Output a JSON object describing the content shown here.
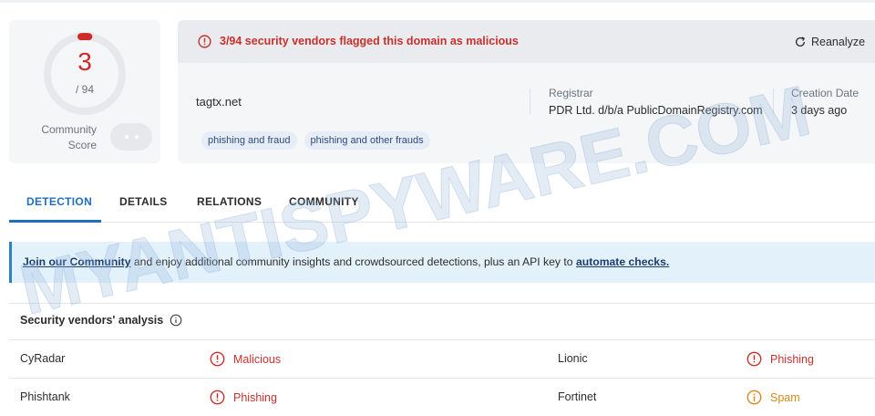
{
  "score": {
    "value": "3",
    "total": "/ 94",
    "community_label_line1": "Community",
    "community_label_line2": "Score"
  },
  "alert": {
    "text": "3/94 security vendors flagged this domain as malicious",
    "reanalyze_label": "Reanalyze"
  },
  "domain": "tagtx.net",
  "tags": [
    "phishing and fraud",
    "phishing and other frauds"
  ],
  "registrar": {
    "label": "Registrar",
    "value": "PDR Ltd. d/b/a PublicDomainRegistry.com"
  },
  "creation": {
    "label": "Creation Date",
    "value": "3 days ago"
  },
  "tabs": [
    {
      "label": "DETECTION",
      "active": true
    },
    {
      "label": "DETAILS",
      "active": false
    },
    {
      "label": "RELATIONS",
      "active": false
    },
    {
      "label": "COMMUNITY",
      "active": false
    }
  ],
  "banner": {
    "link1": "Join our Community",
    "middle": " and enjoy additional community insights and crowdsourced detections, plus an API key to ",
    "link2": "automate checks."
  },
  "vendors": {
    "title": "Security vendors' analysis",
    "rows": [
      {
        "left_vendor": "CyRadar",
        "left_verdict": "Malicious",
        "right_vendor": "Lionic",
        "right_verdict": "Phishing"
      },
      {
        "left_vendor": "Phishtank",
        "left_verdict": "Phishing",
        "right_vendor": "Fortinet",
        "right_verdict": "Spam"
      }
    ]
  },
  "watermark": "MYANTISPYWARE.COM",
  "colors": {
    "malicious_red": "#c9302c",
    "spam_orange": "#d8891a",
    "accent_blue": "#1f6fbf"
  }
}
